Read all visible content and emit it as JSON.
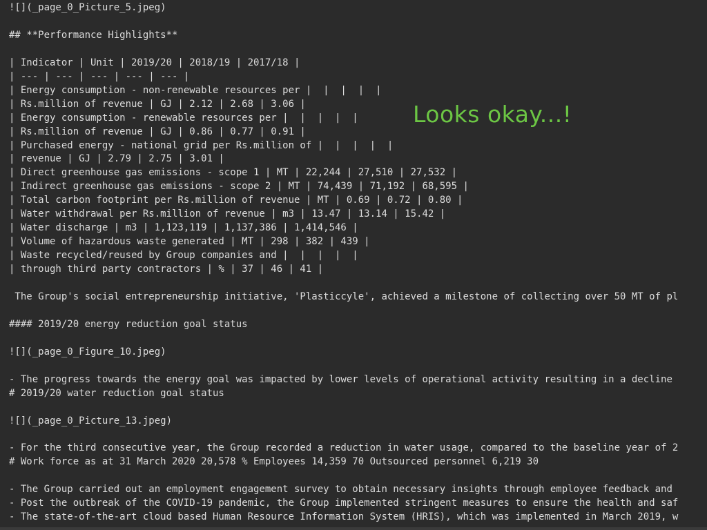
{
  "editor": {
    "lines": [
      "![](_page_0_Picture_5.jpeg)",
      "",
      "## **Performance Highlights**",
      "",
      "| Indicator | Unit | 2019/20 | 2018/19 | 2017/18 |",
      "| --- | --- | --- | --- | --- |",
      "| Energy consumption - non-renewable resources per |  |  |  |  |",
      "| Rs.million of revenue | GJ | 2.12 | 2.68 | 3.06 |",
      "| Energy consumption - renewable resources per |  |  |  |  |",
      "| Rs.million of revenue | GJ | 0.86 | 0.77 | 0.91 |",
      "| Purchased energy - national grid per Rs.million of |  |  |  |  |",
      "| revenue | GJ | 2.79 | 2.75 | 3.01 |",
      "| Direct greenhouse gas emissions - scope 1 | MT | 22,244 | 27,510 | 27,532 |",
      "| Indirect greenhouse gas emissions - scope 2 | MT | 74,439 | 71,192 | 68,595 |",
      "| Total carbon footprint per Rs.million of revenue | MT | 0.69 | 0.72 | 0.80 |",
      "| Water withdrawal per Rs.million of revenue | m3 | 13.47 | 13.14 | 15.42 |",
      "| Water discharge | m3 | 1,123,119 | 1,137,386 | 1,414,546 |",
      "| Volume of hazardous waste generated | MT | 298 | 382 | 439 |",
      "| Waste recycled/reused by Group companies and |  |  |  |  |",
      "| through third party contractors | % | 37 | 46 | 41 |",
      "",
      " The Group's social entrepreneurship initiative, 'Plasticcyle', achieved a milestone of collecting over 50 MT of pl",
      "",
      "#### 2019/20 energy reduction goal status",
      "",
      "![](_page_0_Figure_10.jpeg)",
      "",
      "- The progress towards the energy goal was impacted by lower levels of operational activity resulting in a decline",
      "# 2019/20 water reduction goal status",
      "",
      "![](_page_0_Picture_13.jpeg)",
      "",
      "- For the third consecutive year, the Group recorded a reduction in water usage, compared to the baseline year of 2",
      "# Work force as at 31 March 2020 20,578 % Employees 14,359 70 Outsourced personnel 6,219 30",
      "",
      "- The Group carried out an employment engagement survey to obtain necessary insights through employee feedback and",
      "- Post the outbreak of the COVID-19 pandemic, the Group implemented stringent measures to ensure the health and saf",
      "- The state-of-the-art cloud based Human Resource Information System (HRIS), which was implemented in March 2019, w"
    ]
  },
  "annotation": {
    "text": "Looks okay...!",
    "color": "#6cc644"
  }
}
